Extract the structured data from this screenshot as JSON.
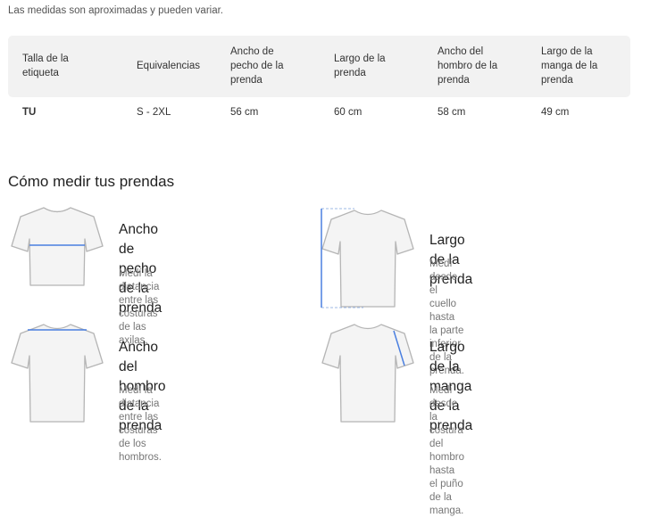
{
  "note": "Las medidas son aproximadas y pueden variar.",
  "table": {
    "headers": [
      "Talla de la etiqueta",
      "Equivalencias",
      "Ancho de pecho de la prenda",
      "Largo de la prenda",
      "Ancho del hombro de la prenda",
      "Largo de la manga de la prenda"
    ],
    "header_lines": [
      [
        "Talla de la",
        "etiqueta"
      ],
      [
        "Equivalencias"
      ],
      [
        "Ancho de",
        "pecho de la",
        "prenda"
      ],
      [
        "Largo de la",
        "prenda"
      ],
      [
        "Ancho del",
        "hombro de la",
        "prenda"
      ],
      [
        "Largo de la",
        "manga de la",
        "prenda"
      ]
    ],
    "rows": [
      [
        "TU",
        "S - 2XL",
        "56 cm",
        "60 cm",
        "58 cm",
        "49 cm"
      ]
    ]
  },
  "guide": {
    "title": "Cómo medir tus prendas",
    "cards": [
      {
        "title_lines": [
          "Ancho de pecho de la",
          "prenda"
        ],
        "desc_lines": [
          "Medí la distancia entre las costuras",
          "de las axilas."
        ],
        "icon": "tshirt-chest-width-icon"
      },
      {
        "title_lines": [
          "Largo de la prenda"
        ],
        "desc_lines": [
          "Medí desde el cuello hasta la parte",
          "inferior de la prenda."
        ],
        "icon": "tshirt-length-icon"
      },
      {
        "title_lines": [
          "Ancho del hombro de la",
          "prenda"
        ],
        "desc_lines": [
          "Medí la distancia entre las costuras",
          "de los hombros."
        ],
        "icon": "tshirt-shoulder-width-icon"
      },
      {
        "title_lines": [
          "Largo de la manga de la",
          "prenda"
        ],
        "desc_lines": [
          "Medí desde la costura del hombro",
          "hasta el puño de la manga."
        ],
        "icon": "tshirt-sleeve-length-icon"
      }
    ]
  },
  "colors": {
    "measure_line": "#4a7fe0",
    "shirt_fill": "#f4f4f4",
    "shirt_stroke": "#b5b5b5",
    "header_bg": "#f2f2f2"
  }
}
